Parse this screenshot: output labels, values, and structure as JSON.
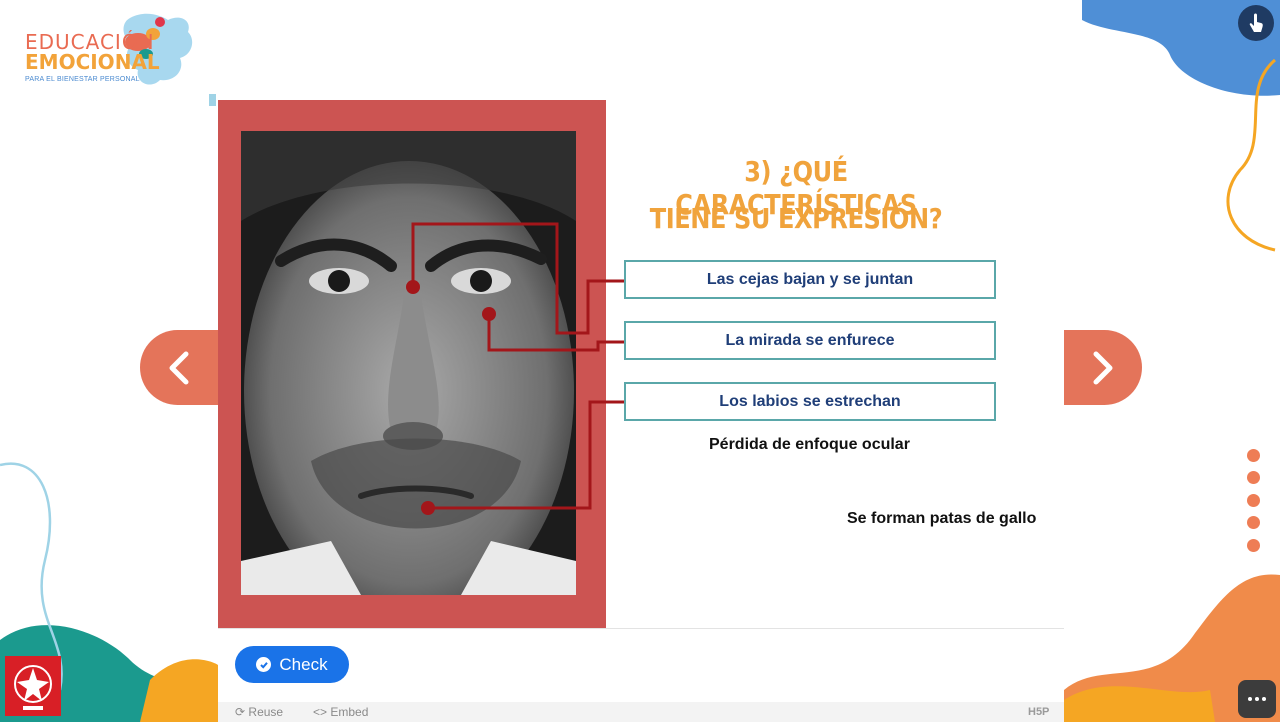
{
  "logo": {
    "line1": "EDUCACIÓN",
    "line2": "EMOCIONAL",
    "line3": "PARA EL BIENESTAR PERSONAL"
  },
  "question": {
    "line1": "3) ¿QUÉ CARACTERÍSTICAS",
    "line2": "TIENE SU EXPRESIÓN?"
  },
  "drop_zones": [
    "Las cejas bajan y se juntan",
    "La mirada se enfurece",
    "Los labios se estrechan"
  ],
  "draggables": [
    "Pérdida de enfoque ocular",
    "Se forman patas de gallo"
  ],
  "buttons": {
    "check": "Check"
  },
  "footer": {
    "reuse": "Reuse",
    "embed": "Embed",
    "h5p": "H5P"
  },
  "icons": {
    "prev": "chevron-left-icon",
    "next": "chevron-right-icon",
    "check": "checkmark-circle-icon",
    "reuse": "refresh-icon",
    "embed": "code-icon",
    "accessibility": "hand-pointer-icon",
    "more": "more-dots-icon"
  },
  "colors": {
    "frame": "#cc5452",
    "title": "#f0a33c",
    "drop_border": "#5aa7a9",
    "drop_text": "#1f3e78",
    "connector": "#a3161a",
    "nav": "#e4745a",
    "check": "#1a73e8",
    "blue_blob": "#4f8fd6",
    "orange_blob": "#f08b4a",
    "yellow_blob": "#f5a623",
    "teal_blob": "#1b9a8e"
  }
}
